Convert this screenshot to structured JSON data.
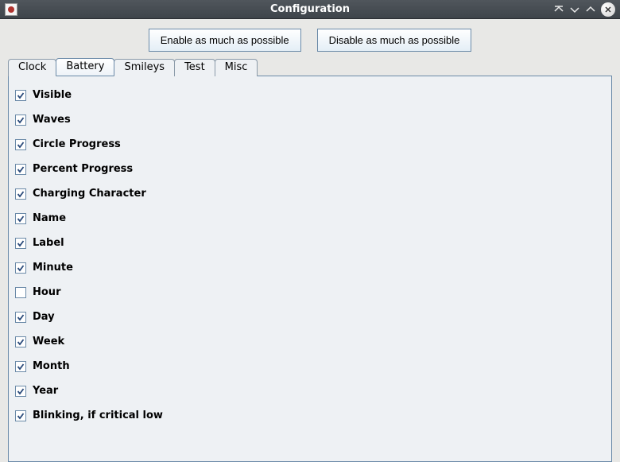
{
  "window": {
    "title": "Configuration"
  },
  "buttons": {
    "enable": "Enable as much as possible",
    "disable": "Disable as much as possible"
  },
  "tabs": [
    {
      "label": "Clock",
      "active": false
    },
    {
      "label": "Battery",
      "active": true
    },
    {
      "label": "Smileys",
      "active": false
    },
    {
      "label": "Test",
      "active": false
    },
    {
      "label": "Misc",
      "active": false
    }
  ],
  "options": [
    {
      "label": "Visible",
      "checked": true
    },
    {
      "label": "Waves",
      "checked": true
    },
    {
      "label": "Circle Progress",
      "checked": true
    },
    {
      "label": "Percent Progress",
      "checked": true
    },
    {
      "label": "Charging Character",
      "checked": true
    },
    {
      "label": "Name",
      "checked": true
    },
    {
      "label": "Label",
      "checked": true
    },
    {
      "label": "Minute",
      "checked": true
    },
    {
      "label": "Hour",
      "checked": false
    },
    {
      "label": "Day",
      "checked": true
    },
    {
      "label": "Week",
      "checked": true
    },
    {
      "label": "Month",
      "checked": true
    },
    {
      "label": "Year",
      "checked": true
    },
    {
      "label": "Blinking, if critical low",
      "checked": true
    }
  ]
}
